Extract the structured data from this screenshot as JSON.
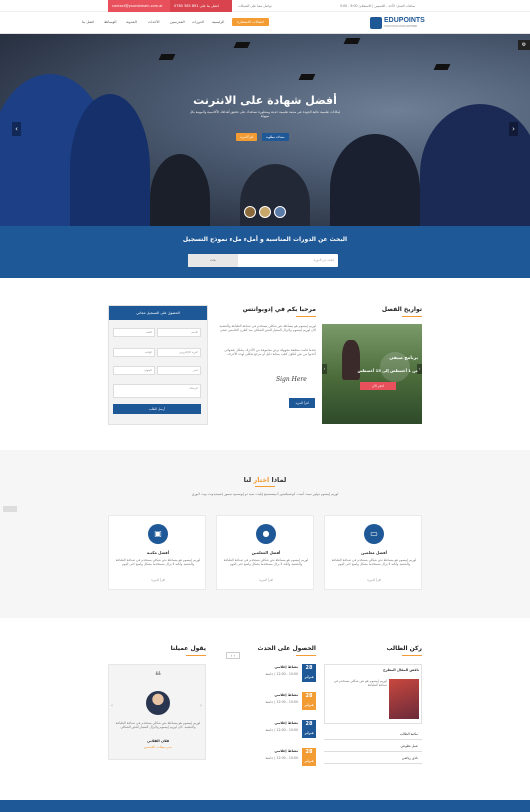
{
  "topbar": {
    "email": "contact@yourdomain.com.ar",
    "phone": "0780 365 891 اتصل بنا على",
    "social_text": "تواصل معنا على الشبكات",
    "left_info": "ساعات العمل: الأحد - الخميس  |  الاستعلام: 9:00 - 5:00"
  },
  "header": {
    "logo_text": "EDUPOINTS",
    "logo_tag": "YOUR EDUCATION PARTNER",
    "register_label": "اتصالات الاستمارة",
    "nav": [
      "الرئيسية",
      "الدورات",
      "المدرسين",
      "الأحداث",
      "المدونة",
      "الوسائط",
      "اتصل بنا"
    ]
  },
  "hero": {
    "title": "أفضل شهادة على الانترنت",
    "subtitle": "إمكانات تعليمية عالية الجودة عبر منصة تعليمية حديثة ومتطورة تساعدك على تحقيق أهدافك الأكاديمية والمهنية بكل سهولة",
    "btn_primary": "اقرأ المزيد",
    "btn_secondary": "مساحة مطلوبة"
  },
  "search": {
    "title": "البحث عن الدورات المناسبة و أملء ملء نموذج التسجيل",
    "placeholder": "ابحث عن الدورة",
    "submit": "بحث"
  },
  "semester": {
    "title": "تواريخ الفصل",
    "card_title": "برنامج صيفي",
    "card_date": "من 1 أغسطس إلى 15 أغسطس",
    "card_btn": "احجز الآن"
  },
  "welcome": {
    "title": "مرحبا بكم في إدوبوانتس",
    "p1": "لوريم إيبسوم هو ببساطة نص شكلي يستخدم في صناعة الطباعة والتنضيد. كان لوريم إيبسوم ولايزال المعيار للنص الشكلي منذ القرن الخامس عشر.",
    "p2": "عندما قامت مطبعة مجهولة برص مجموعة من الأحرف بشكل عشوائي أخذتها من نص لتكوّن كتيّب بمثابة دليل أو مرجع شكلي لهذه الأحرف.",
    "signature": "Sign Here",
    "btn": "اقرأ المزيد"
  },
  "form": {
    "title": "الحصول على التسجيل مجاني",
    "fields": [
      "الاسم",
      "اللقب",
      "البريد الإلكتروني",
      "الهاتف",
      "اختر",
      "العنوان",
      "الرسالة"
    ],
    "submit": "أرسل الطلب"
  },
  "why": {
    "title_a": "لماذا ",
    "title_b": "اختار",
    "title_c": " لنا",
    "text": "لوريم إيبسوم دولور سيت أميت، كونسيكتيتور أديبيسسينغ إيليت، سيد دو إيوسمود تيمبور إنسيديدونت يوت لابوري",
    "cards": [
      {
        "title": "أفضل معلمين",
        "icon": "monitor-icon",
        "text": "لوريم إيبسوم هو ببساطة نص شكلي يستخدم في صناعة الطباعة والتنضيد ولكنه لا يزال مستخدما بشكل واسع حتى اليوم",
        "link": "اقرأ المزيد"
      },
      {
        "title": "أفضل المعلمين",
        "icon": "user-icon",
        "text": "لوريم إيبسوم هو ببساطة نص شكلي يستخدم في صناعة الطباعة والتنضيد ولكنه لا يزال مستخدما بشكل واسع حتى اليوم",
        "link": "اقرأ المزيد"
      },
      {
        "title": "أفضل مكتبة",
        "icon": "money-icon",
        "text": "لوريم إيبسوم هو ببساطة نص شكلي يستخدم في صناعة الطباعة والتنضيد ولكنه لا يزال مستخدما بشكل واسع حتى اليوم",
        "link": "اقرأ المزيد"
      }
    ]
  },
  "student": {
    "title": "ركن الطالب",
    "featured": "ناقش المقال المطرح",
    "featured_text": "لوريم إيبسوم هو نص شكلي يستخدم في صناعة الطباعة",
    "items": [
      "مكتبة الطالب",
      "عمل تطوعي",
      "نادي رياضي"
    ]
  },
  "events": {
    "title": "الحصول على الحدث",
    "items": [
      {
        "day": "28",
        "month": "فبراير",
        "title": "نشاط إعلامي",
        "meta": "10:00 - 12:00  |  جامعة",
        "color": "#1f5896"
      },
      {
        "day": "28",
        "month": "فبراير",
        "title": "نشاط إعلامي",
        "meta": "10:00 - 12:00  |  جامعة",
        "color": "#f39c33"
      },
      {
        "day": "28",
        "month": "فبراير",
        "title": "نشاط إعلامي",
        "meta": "10:00 - 12:00  |  جامعة",
        "color": "#1f5896"
      },
      {
        "day": "28",
        "month": "فبراير",
        "title": "نشاط إعلامي",
        "meta": "10:00 - 12:00  |  جامعة",
        "color": "#f39c33"
      }
    ]
  },
  "testimonial": {
    "title": "يقول عميلنا",
    "quote": "لوريم إيبسوم هو ببساطة نص شكلي يستخدم في صناعة الطباعة والتنضيد. كان لوريم إيبسوم ولايزال المعيار للنص الشكلي",
    "name": "فلان الفلاني",
    "role": "مدير مبيعات، الخمسين"
  },
  "colors": {
    "primary": "#1f5896",
    "accent": "#f39c33",
    "pink": "#e8505b"
  }
}
